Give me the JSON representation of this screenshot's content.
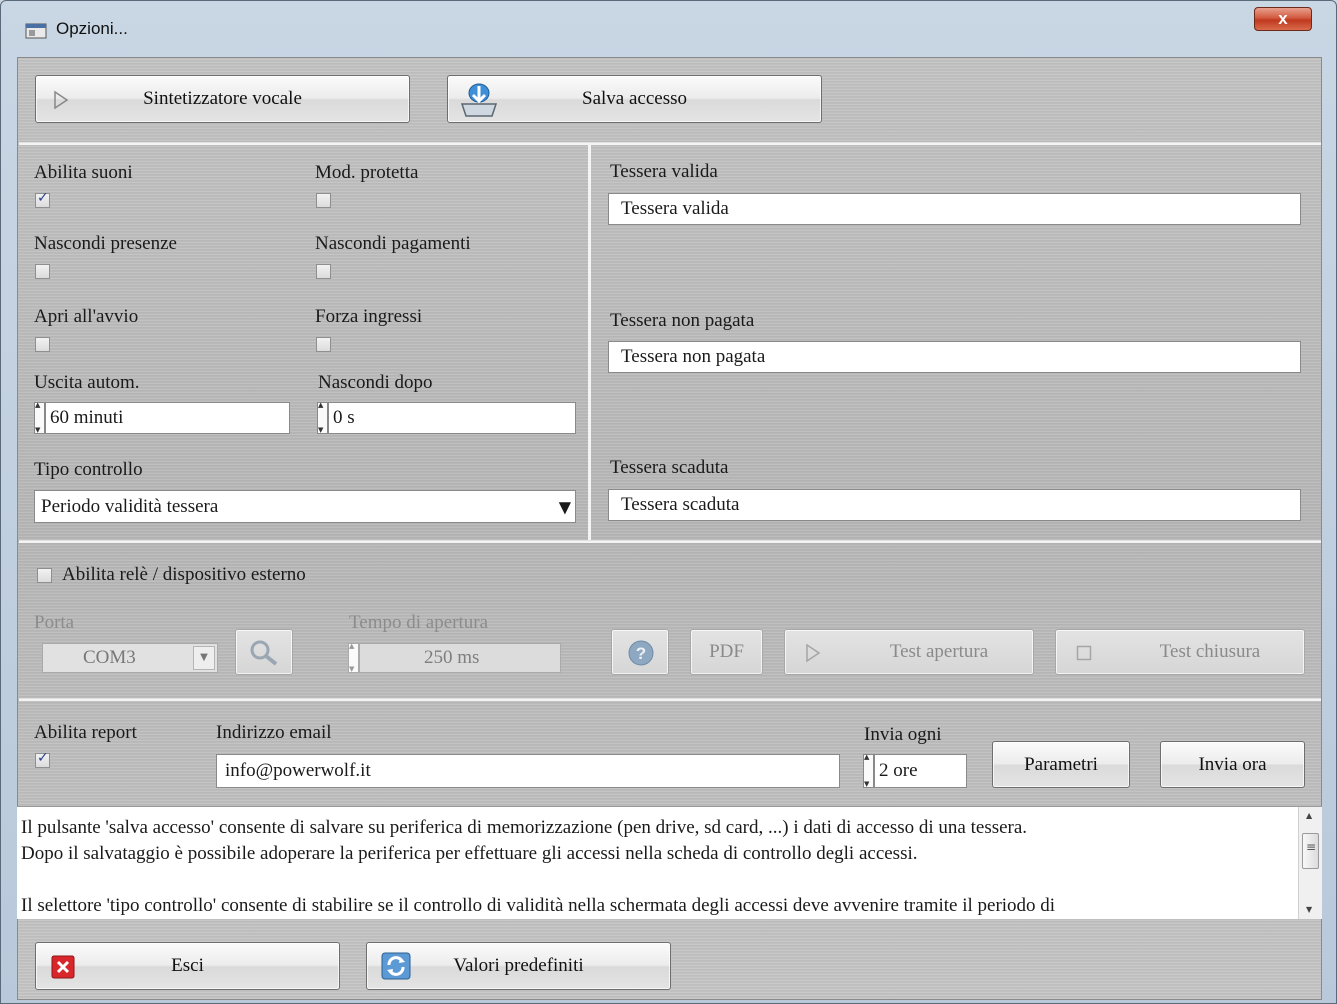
{
  "window": {
    "title": "Opzioni...",
    "close_label": "x"
  },
  "toolbar": {
    "speech_label": "Sintetizzatore vocale",
    "save_access_label": "Salva accesso"
  },
  "options": {
    "abilita_suoni": "Abilita suoni",
    "mod_protetta": "Mod. protetta",
    "nascondi_presenze": "Nascondi presenze",
    "nascondi_pagamenti": "Nascondi pagamenti",
    "apri_avvio": "Apri all'avvio",
    "forza_ingressi": "Forza ingressi",
    "uscita_autom_label": "Uscita autom.",
    "uscita_autom_value": "60 minuti",
    "nascondi_dopo_label": "Nascondi dopo",
    "nascondi_dopo_value": "0 s",
    "tipo_controllo_label": "Tipo controllo",
    "tipo_controllo_value": "Periodo validità tessera",
    "checked": {
      "abilita_suoni": true,
      "mod_protetta": false,
      "nascondi_presenze": false,
      "nascondi_pagamenti": false,
      "apri_avvio": false,
      "forza_ingressi": false
    }
  },
  "messages": {
    "valida_label": "Tessera valida",
    "valida_value": "Tessera valida",
    "non_pagata_label": "Tessera non pagata",
    "non_pagata_value": "Tessera non pagata",
    "scaduta_label": "Tessera scaduta",
    "scaduta_value": "Tessera scaduta"
  },
  "relay": {
    "enable_label": "Abilita relè / dispositivo esterno",
    "enabled": false,
    "porta_label": "Porta",
    "porta_value": "COM3",
    "tempo_label": "Tempo di apertura",
    "tempo_value": "250 ms",
    "pdf_label": "PDF",
    "test_apertura_label": "Test apertura",
    "test_chiusura_label": "Test chiusura"
  },
  "report": {
    "enable_label": "Abilita report",
    "enabled": true,
    "email_label": "Indirizzo email",
    "email_value": "info@powerwolf.it",
    "invia_ogni_label": "Invia ogni",
    "invia_ogni_value": "2 ore",
    "parametri_label": "Parametri",
    "invia_ora_label": "Invia ora"
  },
  "help": {
    "lines": [
      "Il pulsante 'salva accesso' consente di salvare su periferica di memorizzazione (pen drive, sd card, ...) i dati di accesso di una tessera.",
      "Dopo il salvataggio è possibile adoperare la periferica per effettuare gli accessi nella scheda di controllo degli accessi.",
      "",
      "Il selettore 'tipo controllo' consente di stabilire se il controllo di validità nella schermata degli accessi deve avvenire tramite il periodo di"
    ]
  },
  "footer": {
    "esci_label": "Esci",
    "default_label": "Valori predefiniti"
  },
  "colors": {
    "accent_red": "#d8262a",
    "check_blue": "#2b3f8c",
    "panel": "#bdbdbd"
  }
}
